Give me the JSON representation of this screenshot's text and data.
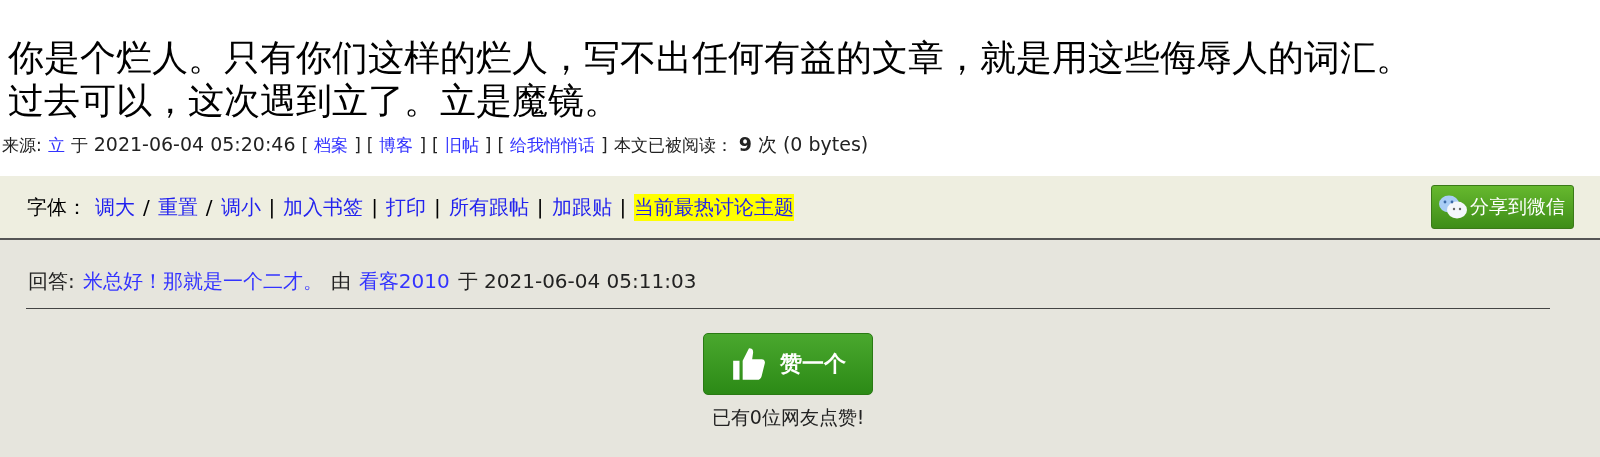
{
  "title_lines": [
    "你是个烂人。只有你们这样的烂人，写不出任何有益的文章，就是用这些侮辱人的词汇。",
    "过去可以，这次遇到立了。立是魔镜。"
  ],
  "meta": [
    {
      "kind": "text",
      "text": "来源:"
    },
    {
      "kind": "link",
      "text": "立"
    },
    {
      "kind": "text",
      "text": "于"
    },
    {
      "kind": "date",
      "text": "2021-06-04 05:20:46"
    },
    {
      "kind": "text",
      "text": "["
    },
    {
      "kind": "link",
      "text": "档案"
    },
    {
      "kind": "text",
      "text": "]"
    },
    {
      "kind": "text",
      "text": "["
    },
    {
      "kind": "link",
      "text": "博客"
    },
    {
      "kind": "text",
      "text": "]"
    },
    {
      "kind": "text",
      "text": "["
    },
    {
      "kind": "link",
      "text": "旧帖"
    },
    {
      "kind": "text",
      "text": "]"
    },
    {
      "kind": "text",
      "text": "["
    },
    {
      "kind": "link",
      "text": "给我悄悄话"
    },
    {
      "kind": "text",
      "text": "]"
    },
    {
      "kind": "text",
      "text": "本文已被阅读："
    },
    {
      "kind": "bold",
      "text": "9"
    },
    {
      "kind": "date",
      "text": "次 (0 bytes)"
    }
  ],
  "toolbar": {
    "label": "字体：",
    "items": [
      {
        "kind": "link",
        "text": "调大",
        "highlighted": false
      },
      {
        "kind": "sep",
        "text": "/"
      },
      {
        "kind": "link",
        "text": "重置",
        "highlighted": false
      },
      {
        "kind": "sep",
        "text": "/"
      },
      {
        "kind": "link",
        "text": "调小",
        "highlighted": false
      },
      {
        "kind": "sep",
        "text": "|"
      },
      {
        "kind": "link",
        "text": "加入书签",
        "highlighted": false
      },
      {
        "kind": "sep",
        "text": "|"
      },
      {
        "kind": "link",
        "text": "打印",
        "highlighted": false
      },
      {
        "kind": "sep",
        "text": "|"
      },
      {
        "kind": "link",
        "text": "所有跟帖",
        "highlighted": false
      },
      {
        "kind": "sep",
        "text": "|"
      },
      {
        "kind": "link",
        "text": "加跟贴",
        "highlighted": false
      },
      {
        "kind": "sep",
        "text": "|"
      },
      {
        "kind": "link",
        "text": "当前最热讨论主题",
        "highlighted": true
      }
    ],
    "share_button": "分享到微信"
  },
  "reply": [
    {
      "kind": "text",
      "text": "回答:"
    },
    {
      "kind": "link",
      "text": "米总好！那就是一个二才。"
    },
    {
      "kind": "text",
      "text": "由"
    },
    {
      "kind": "link",
      "text": "看客2010"
    },
    {
      "kind": "text",
      "text": "于 2021-06-04 05:11:03"
    }
  ],
  "like_button": "赞一个",
  "like_count": "已有0位网友点赞!"
}
